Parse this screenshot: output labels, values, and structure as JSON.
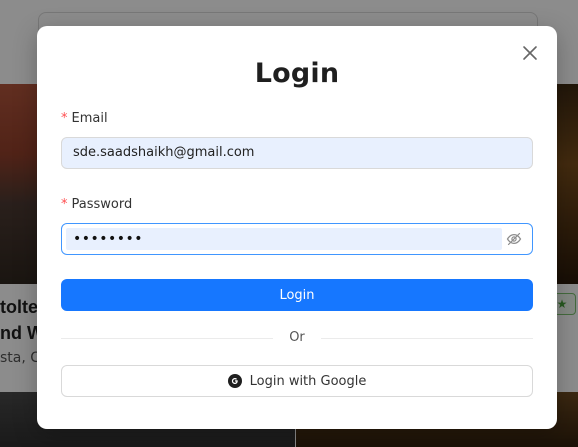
{
  "background": {
    "card_title_lines": [
      "tolte",
      "nd W"
    ],
    "card_subtitle": "sta, C",
    "star_icon": "star-icon"
  },
  "modal": {
    "title": "Login",
    "close_icon": "close-icon",
    "email": {
      "required_mark": "*",
      "label": "Email",
      "value": "sde.saadshaikh@gmail.com"
    },
    "password": {
      "required_mark": "*",
      "label": "Password",
      "masked_value": "••••••••",
      "toggle_icon": "eye-invisible-icon"
    },
    "login_button": "Login",
    "divider_text": "Or",
    "google_button": {
      "label": "Login with Google",
      "icon": "google-icon"
    }
  },
  "colors": {
    "primary": "#1677ff",
    "required": "#ff4d4f",
    "autofill": "#e8f0fe"
  }
}
